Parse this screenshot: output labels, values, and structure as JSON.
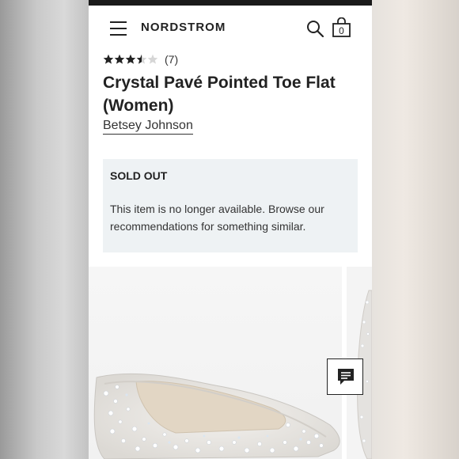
{
  "header": {
    "brand": "NORDSTROM",
    "bag_count": "0",
    "icons": [
      "menu-icon",
      "search-icon",
      "bag-icon"
    ]
  },
  "product": {
    "rating_value": 3.5,
    "rating_max": 5,
    "review_count": "(7)",
    "title": "Crystal Pavé Pointed Toe Flat (Women)",
    "brand": "Betsey Johnson"
  },
  "availability": {
    "status": "SOLD OUT",
    "message": "This item is no longer available. Browse our recommendations for something similar."
  },
  "gallery": {
    "images": [
      "product-image-shoe-side",
      "product-image-shoe-alt"
    ]
  },
  "chat": {
    "icon": "chat-icon"
  },
  "colors": {
    "header_bar": "#1a1a1a",
    "star_filled": "#222222",
    "star_empty": "#d6d6d6",
    "notice_bg": "#eef2f4"
  }
}
